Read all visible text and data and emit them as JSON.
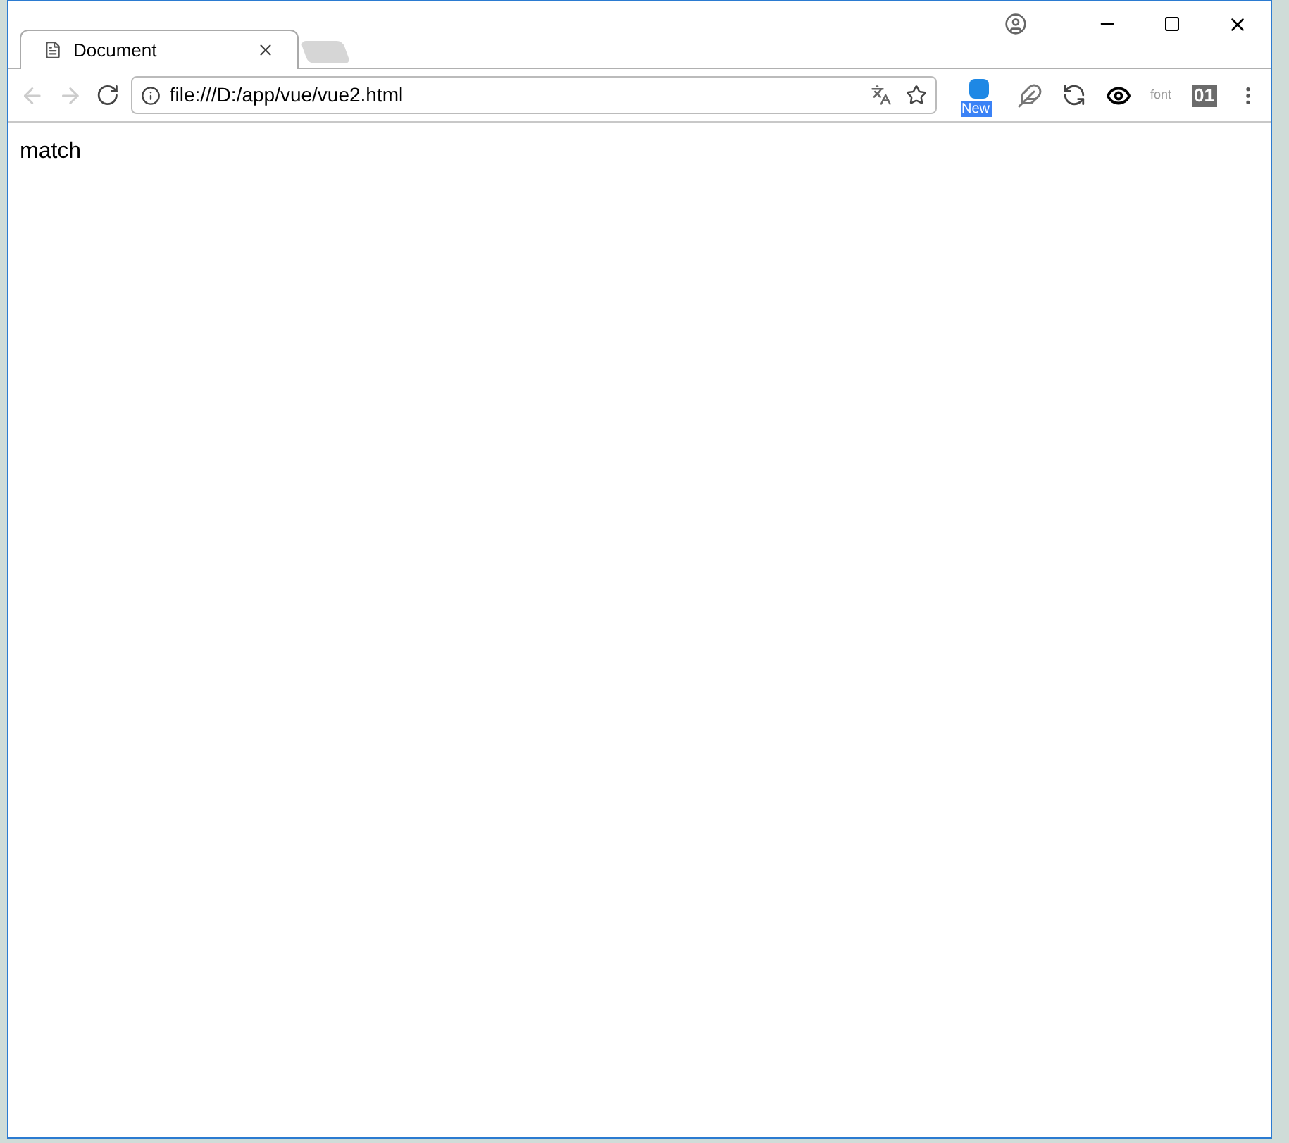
{
  "tabs": [
    {
      "title": "Document",
      "selected": true
    }
  ],
  "address": {
    "url": "file:///D:/app/vue/vue2.html"
  },
  "extensions": [
    {
      "kind": "badge",
      "label": "New"
    },
    {
      "kind": "feather"
    },
    {
      "kind": "sync"
    },
    {
      "kind": "eye"
    },
    {
      "kind": "text",
      "label": "font"
    },
    {
      "kind": "block",
      "label": "01"
    }
  ],
  "page": {
    "text": "match"
  }
}
